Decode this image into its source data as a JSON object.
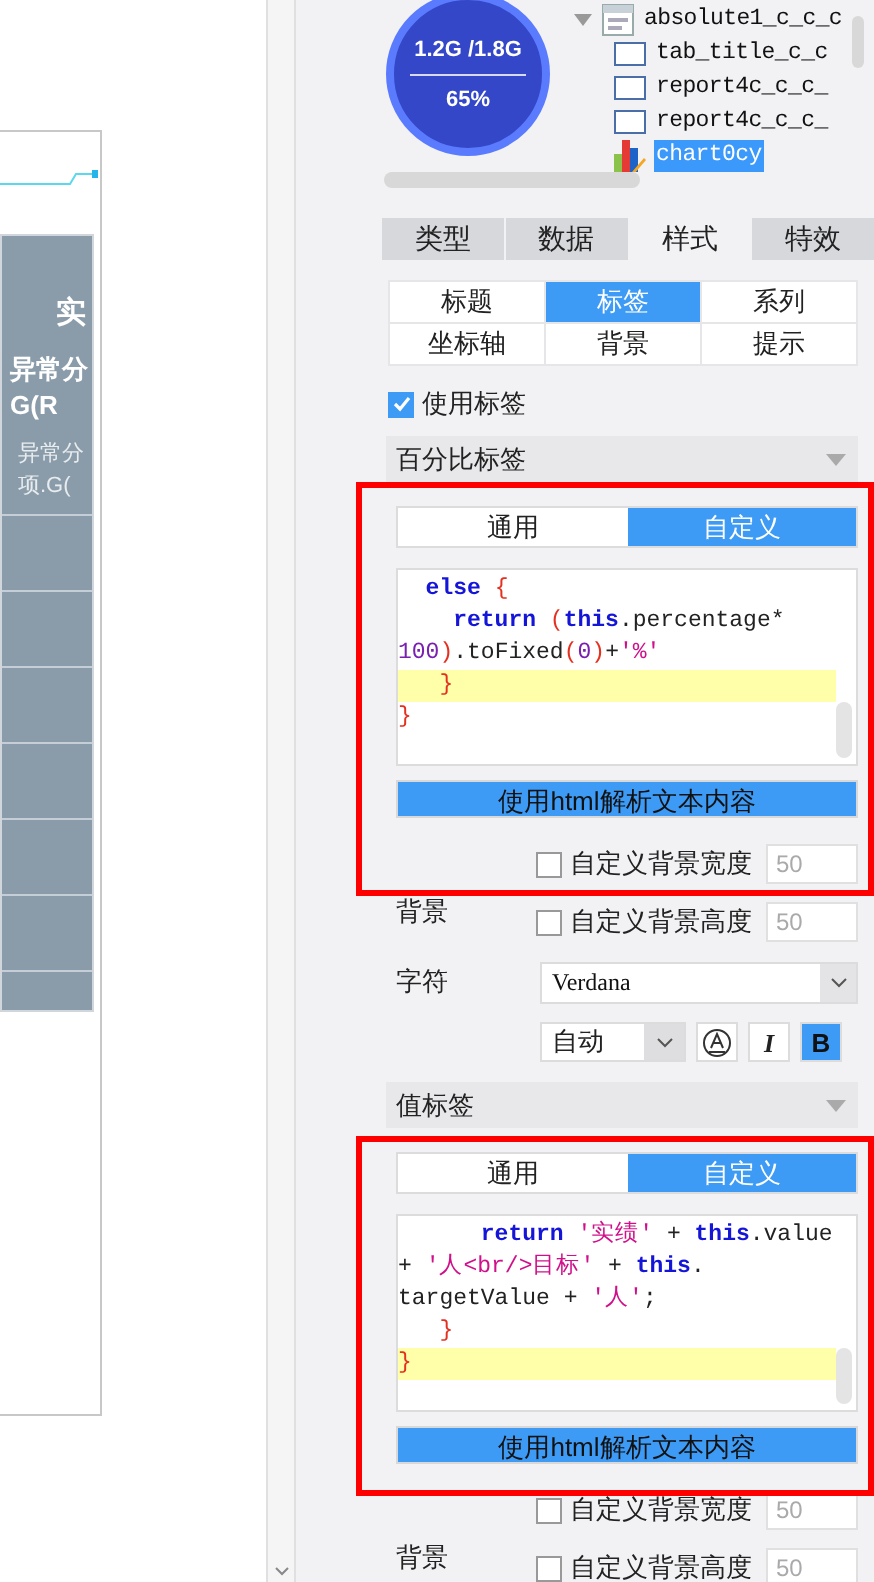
{
  "canvas": {
    "table_cells": [
      {
        "text": "实",
        "kind": "title"
      },
      {
        "text": "异常分",
        "kind": "header"
      },
      {
        "text": "G(R",
        "kind": "header"
      },
      {
        "text": "异常分",
        "kind": "sub"
      },
      {
        "text": "项.G(",
        "kind": "sub"
      }
    ]
  },
  "memory_gauge": {
    "usage": "1.2G /1.8G",
    "percent": "65%"
  },
  "tree": {
    "items": [
      {
        "label": "absolute1_c_c_c",
        "kind": "container",
        "expanded": true,
        "selected": false,
        "children": [
          {
            "label": "tab_title_c_c",
            "kind": "frame",
            "selected": false
          },
          {
            "label": "report4c_c_c_",
            "kind": "frame",
            "selected": false
          },
          {
            "label": "report4c_c_c_",
            "kind": "frame",
            "selected": false
          },
          {
            "label": "chart0cy",
            "kind": "chart",
            "selected": true
          }
        ]
      }
    ]
  },
  "tabs": [
    {
      "label": "类型",
      "selected": false
    },
    {
      "label": "数据",
      "selected": false
    },
    {
      "label": "样式",
      "selected": true
    },
    {
      "label": "特效",
      "selected": false
    }
  ],
  "sub_tabs": [
    {
      "label": "标题",
      "selected": false
    },
    {
      "label": "标签",
      "selected": true
    },
    {
      "label": "系列",
      "selected": false
    },
    {
      "label": "坐标轴",
      "selected": false
    },
    {
      "label": "背景",
      "selected": false
    },
    {
      "label": "提示",
      "selected": false
    }
  ],
  "use_label": {
    "label": "使用标签",
    "checked": true
  },
  "sections": [
    {
      "title": "百分比标签",
      "annotated": true,
      "mode_tabs": [
        {
          "label": "通用",
          "selected": false
        },
        {
          "label": "自定义",
          "selected": true
        }
      ],
      "code_lines": [
        {
          "current": false,
          "tokens": [
            {
              "kind": "keyword",
              "text": "  else"
            },
            {
              "kind": "paren",
              "text": " {"
            }
          ]
        },
        {
          "current": false,
          "tokens": [
            {
              "kind": "keyword",
              "text": "    return"
            },
            {
              "kind": "paren",
              "text": " ("
            },
            {
              "kind": "keyword",
              "text": "this"
            },
            {
              "kind": "plain",
              "text": ".percentage*"
            }
          ]
        },
        {
          "current": false,
          "tokens": [
            {
              "kind": "number",
              "text": "100"
            },
            {
              "kind": "paren",
              "text": ")"
            },
            {
              "kind": "plain",
              "text": ".toFixed"
            },
            {
              "kind": "paren",
              "text": "("
            },
            {
              "kind": "number",
              "text": "0"
            },
            {
              "kind": "paren",
              "text": ")"
            },
            {
              "kind": "plain",
              "text": "+"
            },
            {
              "kind": "string",
              "text": "'%'"
            }
          ]
        },
        {
          "current": true,
          "tokens": [
            {
              "kind": "paren",
              "text": "   }"
            }
          ]
        },
        {
          "current": false,
          "tokens": [
            {
              "kind": "paren",
              "text": "}"
            }
          ]
        }
      ],
      "html_button": "使用html解析文本内容",
      "bg_label": "背景",
      "bg_width": {
        "label": "自定义背景宽度",
        "checked": false,
        "value": "50"
      },
      "bg_height": {
        "label": "自定义背景高度",
        "checked": false,
        "value": "50"
      },
      "font": {
        "label": "字符",
        "family": "Verdana",
        "size": "自动",
        "italic": {
          "label": "I",
          "selected": false
        },
        "bold": {
          "label": "B",
          "selected": true
        }
      }
    },
    {
      "title": "值标签",
      "annotated": true,
      "mode_tabs": [
        {
          "label": "通用",
          "selected": false
        },
        {
          "label": "自定义",
          "selected": true
        }
      ],
      "code_lines": [
        {
          "current": false,
          "tokens": [
            {
              "kind": "keyword",
              "text": "      return"
            },
            {
              "kind": "string",
              "text": " '实绩'"
            },
            {
              "kind": "plain",
              "text": " + "
            },
            {
              "kind": "keyword",
              "text": "this"
            },
            {
              "kind": "plain",
              "text": ".value"
            }
          ]
        },
        {
          "current": false,
          "tokens": [
            {
              "kind": "plain",
              "text": "+ "
            },
            {
              "kind": "string",
              "text": "'人<br/>目标'"
            },
            {
              "kind": "plain",
              "text": " + "
            },
            {
              "kind": "keyword",
              "text": "this"
            },
            {
              "kind": "plain",
              "text": "."
            }
          ]
        },
        {
          "current": false,
          "tokens": [
            {
              "kind": "plain",
              "text": "targetValue + "
            },
            {
              "kind": "string",
              "text": "'人'"
            },
            {
              "kind": "plain",
              "text": ";"
            }
          ]
        },
        {
          "current": false,
          "tokens": [
            {
              "kind": "paren",
              "text": "   }"
            }
          ]
        },
        {
          "current": true,
          "tokens": [
            {
              "kind": "paren",
              "text": "}"
            }
          ]
        }
      ],
      "html_button": "使用html解析文本内容",
      "bg_label": "背景",
      "bg_width": {
        "label": "自定义背景宽度",
        "checked": false,
        "value": "50"
      },
      "bg_height": {
        "label": "自定义背景高度",
        "checked": false,
        "value": "50"
      }
    }
  ]
}
